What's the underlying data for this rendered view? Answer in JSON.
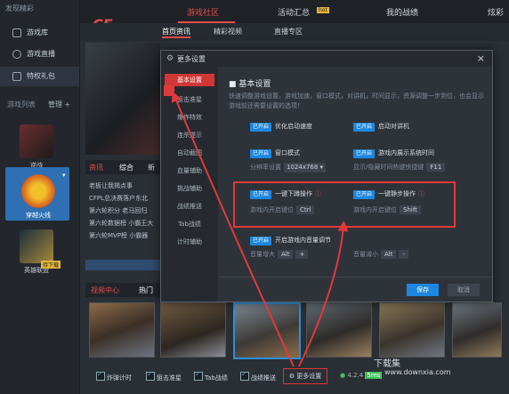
{
  "sidebar": {
    "top_label": "发现精彩",
    "items": [
      {
        "label": "游戏库",
        "icon": "game-library-icon"
      },
      {
        "label": "游戏直播",
        "icon": "live-icon"
      },
      {
        "label": "特权礼包",
        "icon": "gift-icon"
      }
    ],
    "list_label": "游戏列表",
    "manage_label": "管理 +",
    "games": [
      {
        "label": "逆战"
      },
      {
        "label": "穿越火线"
      },
      {
        "label": "英雄联盟",
        "badge": "待下载"
      }
    ]
  },
  "topnav": {
    "tabs": [
      {
        "label": "游戏社区",
        "active": true
      },
      {
        "label": "活动汇总"
      },
      {
        "label": "我的战绩"
      },
      {
        "label": "炫彩"
      }
    ],
    "hot_badge": "hot"
  },
  "subnav": {
    "tabs": [
      {
        "label": "首页资讯",
        "active": true
      },
      {
        "label": "精彩视频"
      },
      {
        "label": "直播专区"
      }
    ]
  },
  "news": {
    "tabs": [
      "资讯",
      "综合",
      "新"
    ],
    "items": [
      "老板让我揭点事",
      "CFPL总决赛落户东北",
      "第六轮积分 老马回归",
      "第六轮数据榜 小霸王大",
      "第六轮MVP榜 小霸器"
    ]
  },
  "video": {
    "title": "视频中心",
    "tab": "热门"
  },
  "bottombar": {
    "checks": [
      "炸弹计时",
      "狙击准星",
      "Tab战绩",
      "战绩推送"
    ],
    "more_label": "更多设置",
    "version": "4.2.4",
    "status": "5ms"
  },
  "watermark": {
    "brand": "下载集",
    "url": "www.downxia.com"
  },
  "dialog": {
    "title": "更多设置",
    "close": "×",
    "nav": [
      "基本设置",
      "狙击准星",
      "爆炸特效",
      "连杀提示",
      "自动截图",
      "血量辅助",
      "挑战辅助",
      "战绩推送",
      "Tab战绩",
      "计时辅助"
    ],
    "section_title": "基本设置",
    "description": "快速调整游戏设置，游戏加速，窗口模式，对讲机，时间显示，资源调整一步到位，也会显示游戏前还需要设置的选项！",
    "toggle_on": "已开启",
    "toggles": {
      "optimize": "优化启动速度",
      "talkie": "启动对讲机",
      "window": "窗口模式",
      "show_time": "游戏内展示系统时间",
      "one_key_drop": "一键下蹲操作",
      "one_key_walk": "一键静步操作",
      "volume": "开启游戏内音量调节"
    },
    "resolution_label": "分辨率设置",
    "resolution_value": "1024x768",
    "time_hotkey_label": "显示/隐藏时间热键快捷键",
    "time_hotkey": "F11",
    "drop_label": "游戏内开启键位",
    "drop_key": "Ctrl",
    "walk_label": "游戏内开启键位",
    "walk_key": "Shift",
    "vol_up_label": "音量增大",
    "vol_up_keys": [
      "Alt",
      "+"
    ],
    "vol_down_label": "音量减小",
    "vol_down_keys": [
      "Alt",
      "-"
    ],
    "save": "保存",
    "cancel": "取消"
  },
  "colors": {
    "accent_red": "#e34c4c",
    "accent_blue": "#1c86e0",
    "annotation_red": "#e0393b"
  }
}
